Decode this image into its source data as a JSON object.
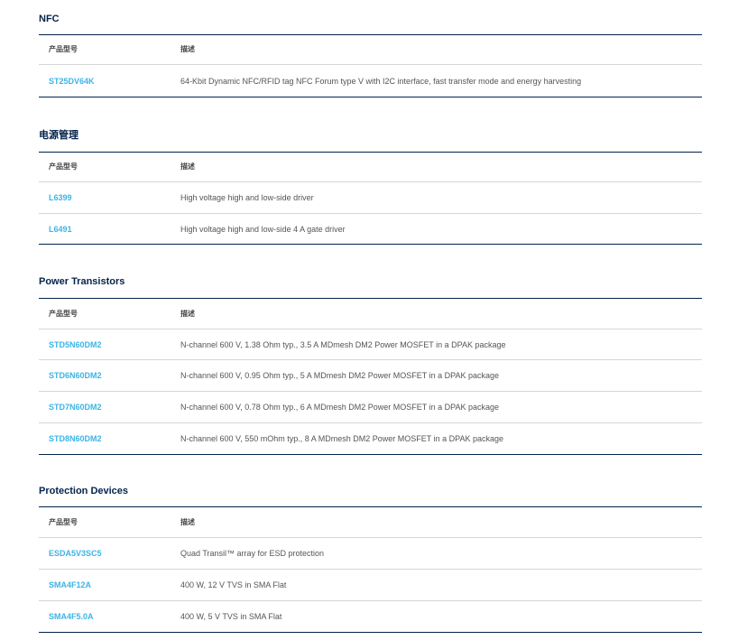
{
  "columns": {
    "part": "产品型号",
    "desc": "描述"
  },
  "sections": [
    {
      "title": "NFC",
      "rows": [
        {
          "part": "ST25DV64K",
          "desc": "64-Kbit Dynamic NFC/RFID tag NFC Forum type V with I2C interface, fast transfer mode and energy harvesting"
        }
      ]
    },
    {
      "title": "电源管理",
      "rows": [
        {
          "part": "L6399",
          "desc": "High voltage high and low-side driver"
        },
        {
          "part": "L6491",
          "desc": "High voltage high and low-side 4 A gate driver"
        }
      ]
    },
    {
      "title": "Power Transistors",
      "rows": [
        {
          "part": "STD5N60DM2",
          "desc": "N-channel 600 V, 1.38 Ohm typ., 3.5 A MDmesh DM2 Power MOSFET in a DPAK package"
        },
        {
          "part": "STD6N60DM2",
          "desc": "N-channel 600 V, 0.95 Ohm typ., 5 A MDmesh DM2 Power MOSFET in a DPAK package"
        },
        {
          "part": "STD7N60DM2",
          "desc": "N-channel 600 V, 0.78 Ohm typ., 6 A MDmesh DM2 Power MOSFET in a DPAK package"
        },
        {
          "part": "STD8N60DM2",
          "desc": "N-channel 600 V, 550 mOhm typ., 8 A MDmesh DM2 Power MOSFET in a DPAK package"
        }
      ]
    },
    {
      "title": "Protection Devices",
      "rows": [
        {
          "part": "ESDA5V3SC5",
          "desc": "Quad Transil™ array for ESD protection"
        },
        {
          "part": "SMA4F12A",
          "desc": "400 W, 12 V TVS in SMA Flat"
        },
        {
          "part": "SMA4F5.0A",
          "desc": "400 W, 5 V TVS in SMA Flat"
        }
      ]
    }
  ]
}
